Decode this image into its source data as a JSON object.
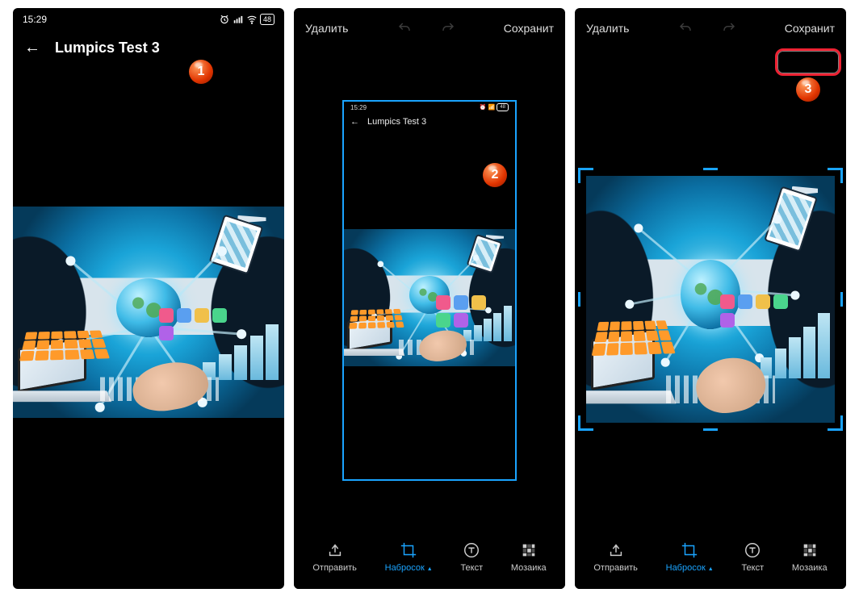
{
  "status": {
    "time": "15:29",
    "battery": "48"
  },
  "screen1": {
    "title": "Lumpics Test 3"
  },
  "editor": {
    "delete": "Удалить",
    "save": "Сохранит",
    "inner_title": "Lumpics Test 3",
    "inner_time": "15:29",
    "inner_batt": "48"
  },
  "toolbar": {
    "send": "Отправить",
    "sketch": "Набросок",
    "text": "Текст",
    "mosaic": "Мозаика"
  },
  "badges": {
    "b1": "1",
    "b2": "2",
    "b3": "3"
  }
}
